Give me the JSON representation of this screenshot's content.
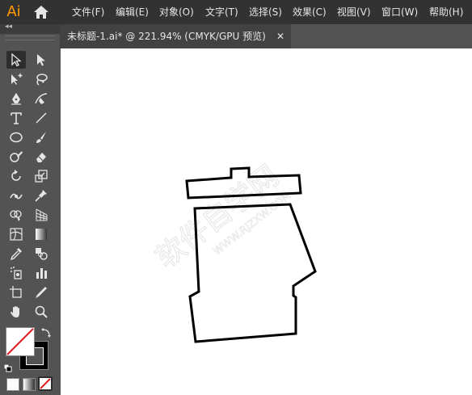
{
  "app": {
    "logo": "Ai"
  },
  "menu": {
    "items": [
      "文件(F)",
      "编辑(E)",
      "对象(O)",
      "文字(T)",
      "选择(S)",
      "效果(C)",
      "视图(V)",
      "窗口(W)",
      "帮助(H)"
    ]
  },
  "panel": {
    "collapse_label": "◂◂"
  },
  "document": {
    "tab_title": "未标题-1.ai* @ 221.94% (CMYK/GPU 预览)",
    "close_label": "✕"
  },
  "watermark": {
    "text": "软件自学网",
    "url": "WWW.RJZXW.COM"
  },
  "colors": {
    "menubar_bg": "#323232",
    "panel_bg": "#535353",
    "tab_bg": "#424242",
    "logo_accent": "#ff9a00",
    "canvas_bg": "#ffffff",
    "none_swatch_red": "#e02020"
  },
  "tools": [
    [
      "selection-tool-icon",
      "direct-selection-tool-icon"
    ],
    [
      "magic-wand-tool-icon",
      "lasso-tool-icon"
    ],
    [
      "pen-tool-icon",
      "curvature-tool-icon"
    ],
    [
      "type-tool-icon",
      "line-segment-tool-icon"
    ],
    [
      "ellipse-tool-icon",
      "paintbrush-tool-icon"
    ],
    [
      "shaper-tool-icon",
      "eraser-tool-icon"
    ],
    [
      "rotate-tool-icon",
      "scale-tool-icon"
    ],
    [
      "width-tool-icon",
      "puppet-warp-tool-icon"
    ],
    [
      "shape-builder-tool-icon",
      "perspective-grid-tool-icon"
    ],
    [
      "mesh-tool-icon",
      "gradient-tool-icon"
    ],
    [
      "eyedropper-tool-icon",
      "blend-tool-icon"
    ],
    [
      "symbol-sprayer-tool-icon",
      "column-graph-tool-icon"
    ],
    [
      "artboard-tool-icon",
      "slice-tool-icon"
    ],
    [
      "hand-tool-icon",
      "zoom-tool-icon"
    ]
  ]
}
